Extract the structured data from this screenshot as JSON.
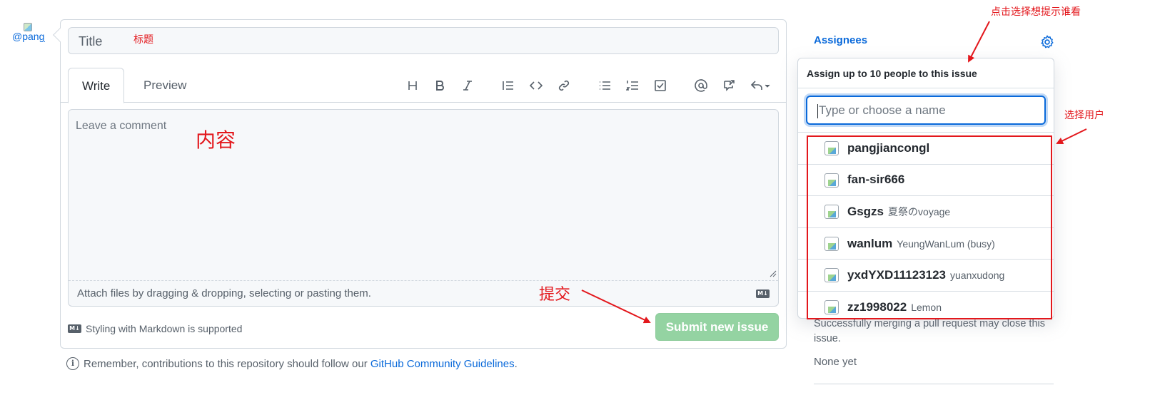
{
  "avatar": {
    "alt_text": "@pangjiancongl"
  },
  "form": {
    "title_placeholder": "Title",
    "tabs": [
      {
        "label": "Write"
      },
      {
        "label": "Preview"
      }
    ],
    "toolbar": [
      "heading-icon",
      "bold-icon",
      "italic-icon",
      "quote-icon",
      "code-icon",
      "link-icon",
      "unordered-list-icon",
      "ordered-list-icon",
      "task-list-icon",
      "mention-icon",
      "cross-reference-icon",
      "reply-icon"
    ],
    "comment_placeholder": "Leave a comment",
    "attach_text": "Attach files by dragging & dropping, selecting or pasting them.",
    "markdown_badge": "M↓",
    "markdown_note": "Styling with Markdown is supported",
    "submit_label": "Submit new issue"
  },
  "footer": {
    "guidelines_prefix": "Remember, contributions to this repository should follow our ",
    "guidelines_link": "GitHub Community Guidelines",
    "guidelines_suffix": "."
  },
  "sidebar": {
    "assignees_label": "Assignees",
    "linked_note": "Successfully merging a pull request may close this issue.",
    "none_yet": "None yet"
  },
  "popover": {
    "header": "Assign up to 10 people to this issue",
    "filter_placeholder": "Type or choose a name",
    "users": [
      {
        "login": "pangjiancongl",
        "name": ""
      },
      {
        "login": "fan-sir666",
        "name": ""
      },
      {
        "login": "Gsgzs",
        "name": "夏祭のvoyage"
      },
      {
        "login": "wanlum",
        "name": "YeungWanLum (busy)"
      },
      {
        "login": "yxdYXD11123123",
        "name": "yuanxudong"
      },
      {
        "login": "zz1998022",
        "name": "Lemon"
      }
    ]
  },
  "annotations": {
    "title": "标题",
    "content": "内容",
    "submit": "提交",
    "select_users": "选择用户",
    "click_select": "点击选择想提示谁看"
  },
  "colors": {
    "accent": "#0969da",
    "submit_disabled": "#94d3a2",
    "annotation_red": "#e3171c",
    "border": "#d0d7de"
  }
}
